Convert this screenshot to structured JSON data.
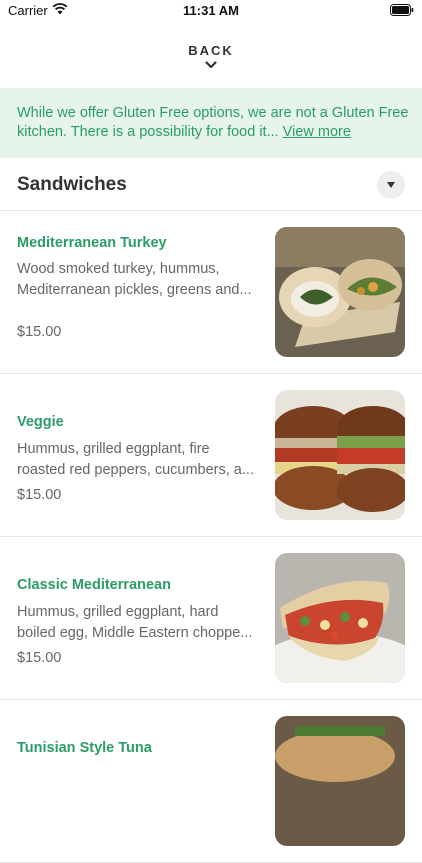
{
  "status_bar": {
    "carrier": "Carrier",
    "time": "11:31 AM"
  },
  "nav": {
    "back_label": "BACK"
  },
  "notice": {
    "text": "While we offer Gluten Free options, we are not a Gluten Free kitchen. There is a possibility for food it...",
    "link": "View more",
    "accent_color": "#2a9d67",
    "background_color": "#e6f4ec"
  },
  "section": {
    "title": "Sandwiches",
    "toggle_icon": "caret-down-icon"
  },
  "items": [
    {
      "name": "Mediterranean Turkey",
      "desc_line1": "Wood smoked turkey, hummus,",
      "desc_line2": "Mediterranean pickles, greens and...",
      "price": "$15.00"
    },
    {
      "name": "Veggie",
      "desc_line1": "Hummus, grilled eggplant, fire",
      "desc_line2": "roasted red peppers, cucumbers, a...",
      "price": "$15.00"
    },
    {
      "name": "Classic Mediterranean",
      "desc_line1": "Hummus, grilled eggplant, hard",
      "desc_line2": "boiled egg, Middle Eastern choppe...",
      "price": "$15.00"
    },
    {
      "name": "Tunisian Style Tuna",
      "price": ""
    }
  ]
}
